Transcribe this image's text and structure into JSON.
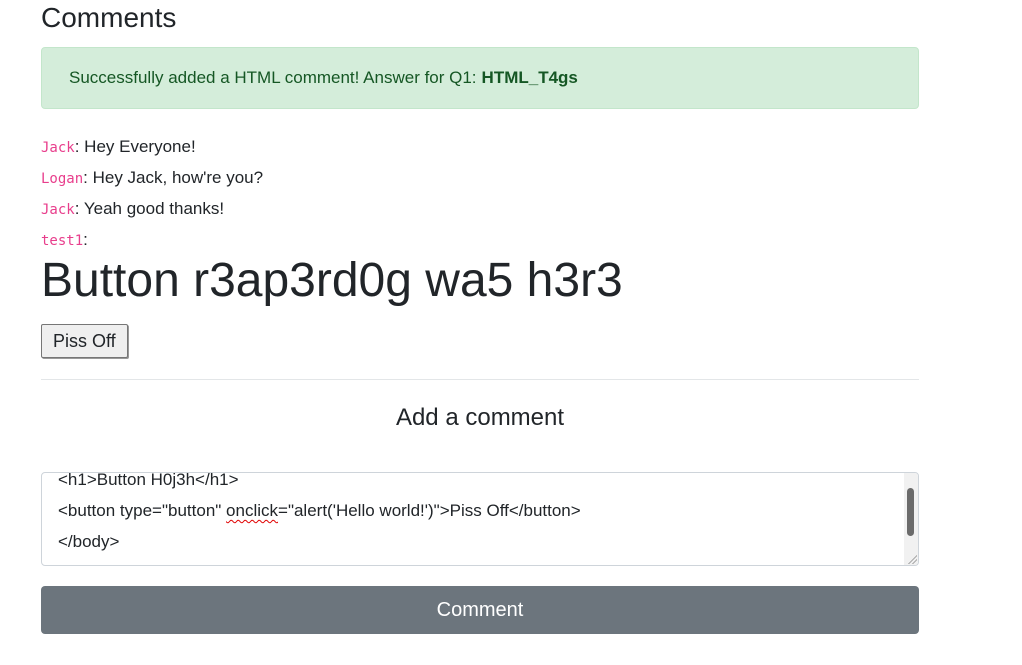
{
  "page": {
    "title": "Comments"
  },
  "alert": {
    "message": "Successfully added a HTML comment! Answer for Q1:",
    "answer": "HTML_T4gs"
  },
  "comments": [
    {
      "author": "Jack",
      "text": ": Hey Everyone!"
    },
    {
      "author": "Logan",
      "text": ": Hey Jack, how're you?"
    },
    {
      "author": "Jack",
      "text": ": Yeah good thanks!"
    },
    {
      "author": "test1",
      "text": ":"
    }
  ],
  "injected": {
    "heading": "Button r3ap3rd0g wa5 h3r3",
    "button_label": "Piss Off"
  },
  "form": {
    "title": "Add a comment",
    "textarea_lines": [
      "<h1>Button H0j3h</h1>",
      "<button type=\"button\" ",
      "onclick",
      "=\"alert('Hello world!')\">Piss Off</button>",
      "</body>"
    ],
    "submit_label": "Comment"
  },
  "colors": {
    "alert_bg": "#d4edda",
    "alert_text": "#155724",
    "author": "#e83e8c",
    "submit_bg": "#6c757d"
  }
}
